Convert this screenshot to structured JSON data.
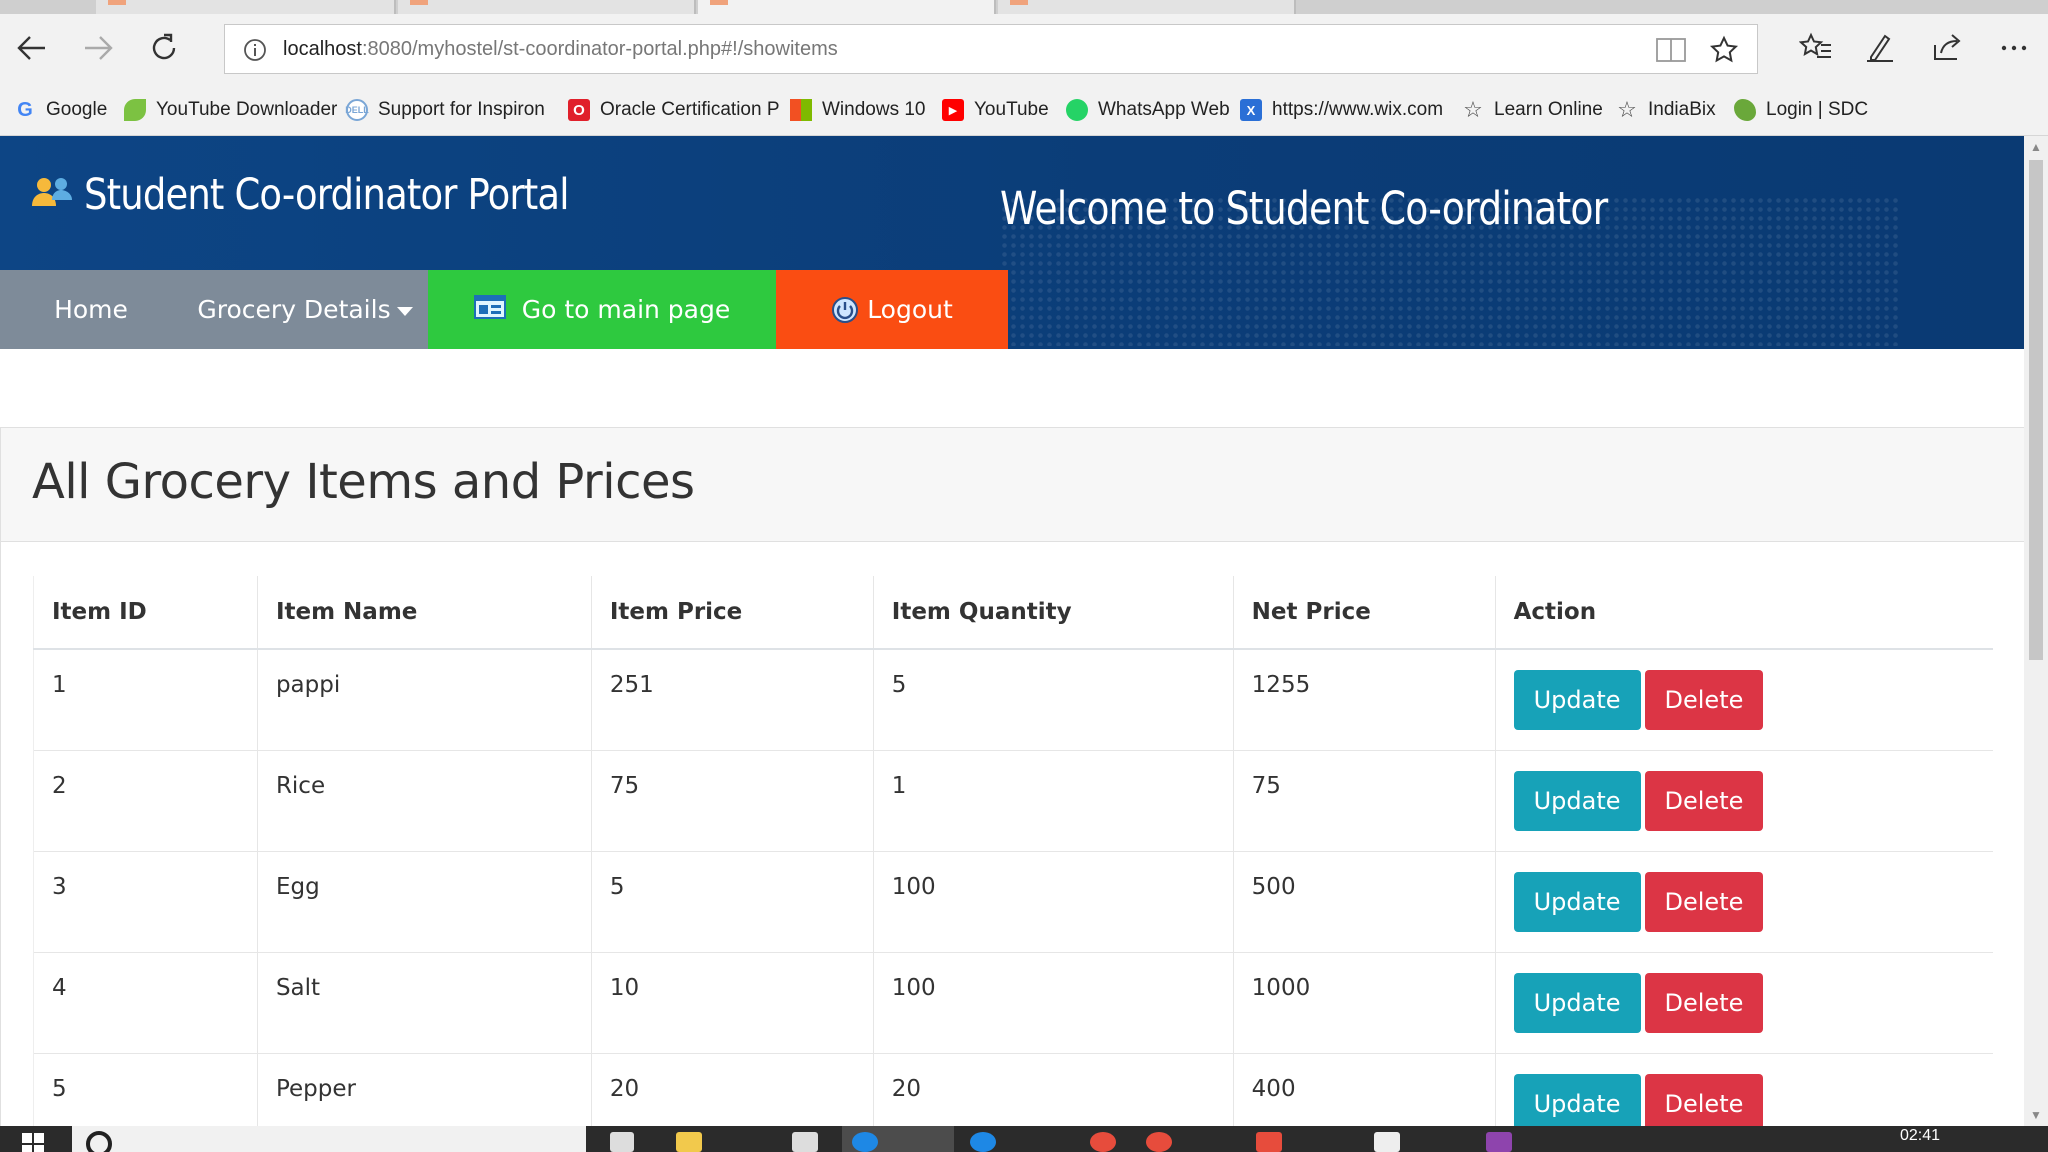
{
  "browser": {
    "url_host": "localhost",
    "url_path": ":8080/myhostel/st-coordinator-portal.php#!/showitems",
    "bookmarks": [
      {
        "label": "Google",
        "icon": "google-icon",
        "color": "#4285f4"
      },
      {
        "label": "YouTube Downloader",
        "icon": "leaf-icon",
        "color": "#7cc242"
      },
      {
        "label": "Support for Inspiron",
        "icon": "dell-icon",
        "color": "#7aa6d6"
      },
      {
        "label": "Oracle Certification P",
        "icon": "oracle-icon",
        "color": "#e0202b"
      },
      {
        "label": "Windows 10",
        "icon": "windows-icon",
        "color": "#00a4ef"
      },
      {
        "label": "YouTube",
        "icon": "youtube-icon",
        "color": "#ff0000"
      },
      {
        "label": "WhatsApp Web",
        "icon": "whatsapp-icon",
        "color": "#25d366"
      },
      {
        "label": "https://www.wix.com",
        "icon": "wix-icon",
        "color": "#2a6fd6"
      },
      {
        "label": "Learn Online",
        "icon": "star-outline-icon",
        "color": "#444444"
      },
      {
        "label": "IndiaBix",
        "icon": "star-outline-icon",
        "color": "#444444"
      },
      {
        "label": "Login | SDC",
        "icon": "sdc-icon",
        "color": "#6aa83a"
      }
    ]
  },
  "header": {
    "portal_title": "Student Co-ordinator Portal",
    "welcome": "Welcome to Student Co-ordinator"
  },
  "menu": {
    "home": "Home",
    "grocery": "Grocery Details",
    "main_page": "Go to main page",
    "logout": "Logout"
  },
  "panel": {
    "title": "All Grocery Items and Prices"
  },
  "table": {
    "columns": [
      "Item ID",
      "Item Name",
      "Item Price",
      "Item Quantity",
      "Net Price",
      "Action"
    ],
    "rows": [
      {
        "id": "1",
        "name": "pappi",
        "price": "251",
        "qty": "5",
        "net": "1255"
      },
      {
        "id": "2",
        "name": "Rice",
        "price": "75",
        "qty": "1",
        "net": "75"
      },
      {
        "id": "3",
        "name": "Egg",
        "price": "5",
        "qty": "100",
        "net": "500"
      },
      {
        "id": "4",
        "name": "Salt",
        "price": "10",
        "qty": "100",
        "net": "1000"
      },
      {
        "id": "5",
        "name": "Pepper",
        "price": "20",
        "qty": "20",
        "net": "400"
      }
    ],
    "update_label": "Update",
    "delete_label": "Delete"
  },
  "taskbar": {
    "clock": "02:41"
  },
  "colors": {
    "banner": "#0b3d78",
    "nav_grey": "#7e8b99",
    "nav_green": "#2ec93f",
    "nav_orange": "#fa4d12",
    "update": "#17a2b8",
    "delete": "#dc3545"
  }
}
